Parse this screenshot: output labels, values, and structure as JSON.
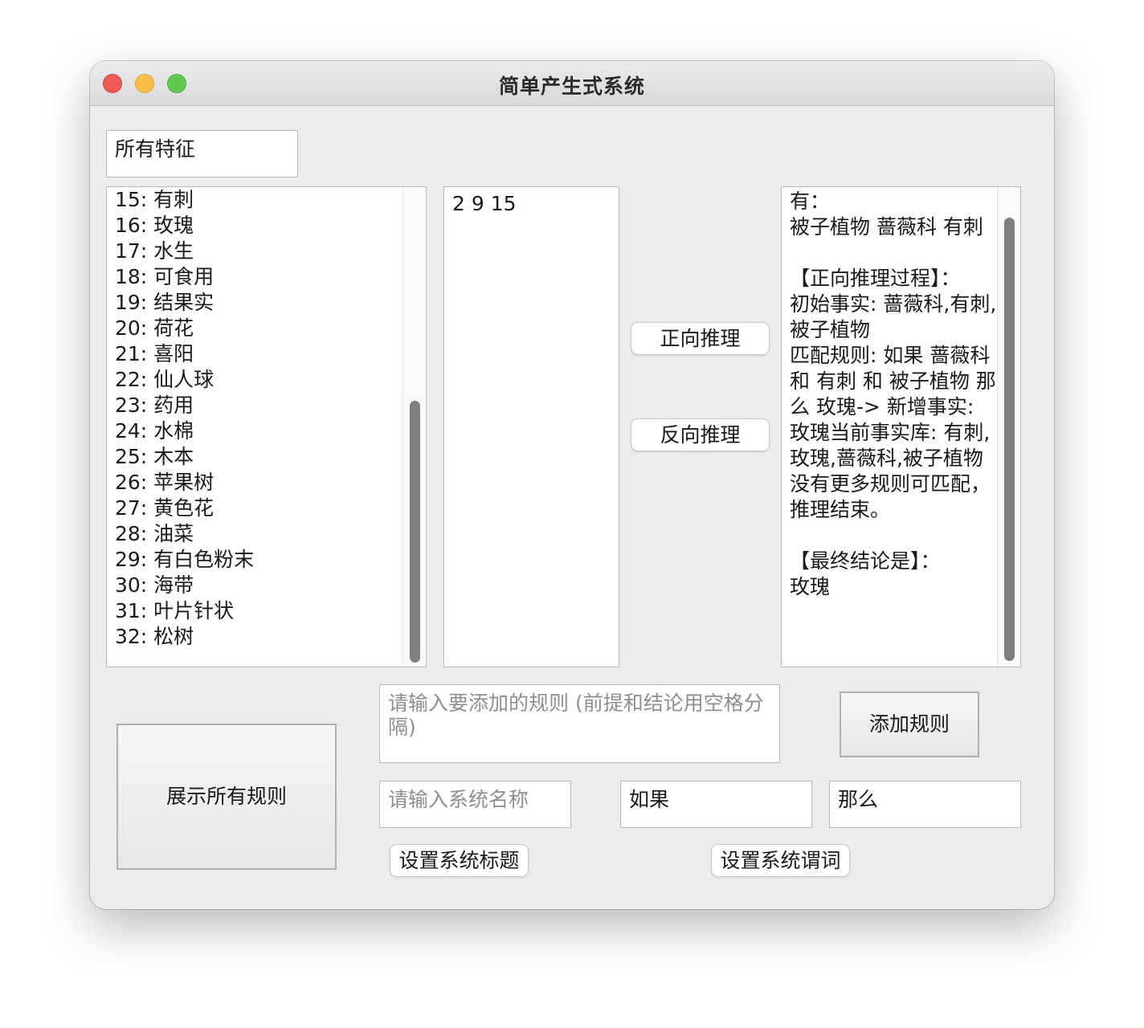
{
  "window": {
    "title": "简单产生式系统"
  },
  "features_header": {
    "value": "所有特征"
  },
  "feature_list": {
    "items": [
      "15: 有刺",
      "16: 玫瑰",
      "17: 水生",
      "18: 可食用",
      "19: 结果实",
      "20: 荷花",
      "21: 喜阳",
      "22: 仙人球",
      "23: 药用",
      "24: 水棉",
      "25: 木本",
      "26: 苹果树",
      "27: 黄色花",
      "28: 油菜",
      "29: 有白色粉末",
      "30: 海带",
      "31: 叶片针状",
      "32: 松树"
    ],
    "scroll_position": 0.55
  },
  "facts_input": {
    "value": "2 9 15"
  },
  "buttons": {
    "forward": "正向推理",
    "backward": "反向推理",
    "add_rule": "添加规则",
    "show_rules": "展示所有规则",
    "set_title": "设置系统标题",
    "set_predicate": "设置系统谓词"
  },
  "result": {
    "text": "有：\n被子植物 蔷薇科 有刺\n\n【正向推理过程】：\n初始事实: 蔷薇科,有刺,被子植物\n匹配规则: 如果 蔷薇科 和 有刺 和 被子植物 那么 玫瑰-> 新增事实: 玫瑰当前事实库: 有刺,玫瑰,蔷薇科,被子植物\n没有更多规则可匹配，推理结束。\n\n【最终结论是】：\n玫瑰"
  },
  "rule_input": {
    "placeholder": "请输入要添加的规则 (前提和结论用空格分隔)"
  },
  "system_name_input": {
    "placeholder": "请输入系统名称"
  },
  "if_input": {
    "value": "如果"
  },
  "then_input": {
    "value": "那么"
  },
  "colors": {
    "close": "#ee5b56",
    "minimize": "#f7be4a",
    "maximize": "#5fc952",
    "window_bg": "#ececec",
    "scroll_thumb": "#7f7f7f"
  }
}
